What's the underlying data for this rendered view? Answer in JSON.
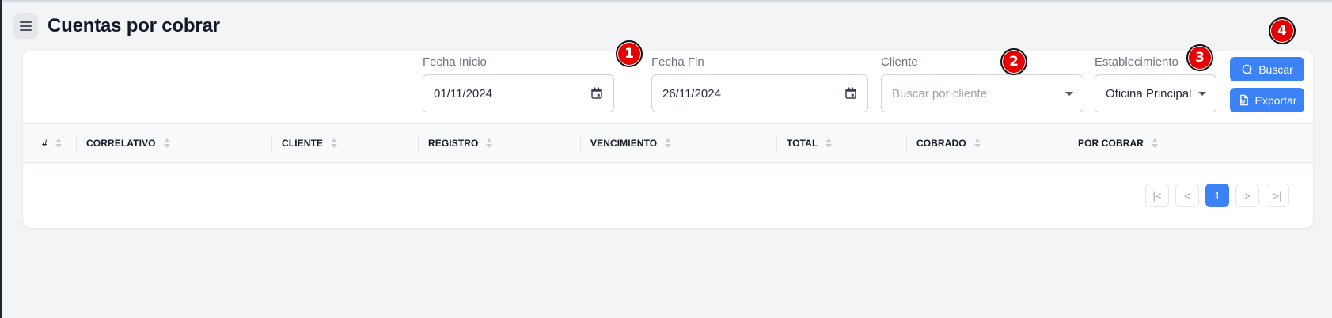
{
  "page": {
    "title": "Cuentas por cobrar"
  },
  "filters": {
    "fecha_inicio": {
      "label": "Fecha Inicio",
      "value": "01/11/2024"
    },
    "fecha_fin": {
      "label": "Fecha Fin",
      "value": "26/11/2024"
    },
    "cliente": {
      "label": "Cliente",
      "placeholder": "Buscar por cliente"
    },
    "establecimiento": {
      "label": "Establecimiento",
      "value": "Oficina Principal"
    }
  },
  "actions": {
    "buscar_label": "Buscar",
    "exportar_label": "Exportar"
  },
  "table": {
    "columns": [
      "#",
      "CORRELATIVO",
      "CLIENTE",
      "REGISTRO",
      "VENCIMIENTO",
      "TOTAL",
      "COBRADO",
      "POR COBRAR"
    ]
  },
  "pagination": {
    "first": "|<",
    "prev": "<",
    "current_page": "1",
    "next": ">",
    "last": ">|"
  },
  "annotations": [
    "1",
    "2",
    "3",
    "4"
  ],
  "colors": {
    "accent": "#3b82f6",
    "marker": "#e60000",
    "background": "#f3f4f6"
  }
}
